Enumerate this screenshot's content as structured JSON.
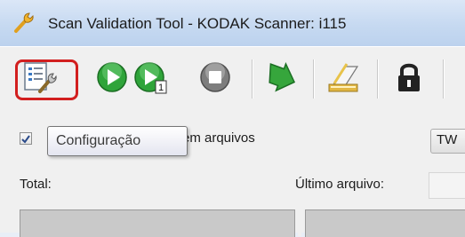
{
  "window": {
    "title": "Scan Validation Tool - KODAK Scanner: i115",
    "icon": "wrench-icon"
  },
  "toolbar": {
    "buttons": [
      {
        "name": "configuration-icon",
        "tooltip": "Configuração"
      },
      {
        "name": "start-scan-icon"
      },
      {
        "name": "scan-one-page-icon"
      },
      {
        "name": "stop-icon"
      },
      {
        "name": "transfer-arrow-icon"
      },
      {
        "name": "scan-document-icon"
      },
      {
        "name": "lock-icon"
      }
    ]
  },
  "tooltip": {
    "text": "Configuração"
  },
  "options": {
    "save_files_label": "em arquivos",
    "save_files_checked": true,
    "driver_select_value": "TW"
  },
  "status": {
    "total_label": "Total:",
    "last_file_label": "Último arquivo:"
  },
  "colors": {
    "highlight": "#d21f1f",
    "titlebar": "#c6d9f1",
    "toolbar": "#f0f0f0"
  }
}
